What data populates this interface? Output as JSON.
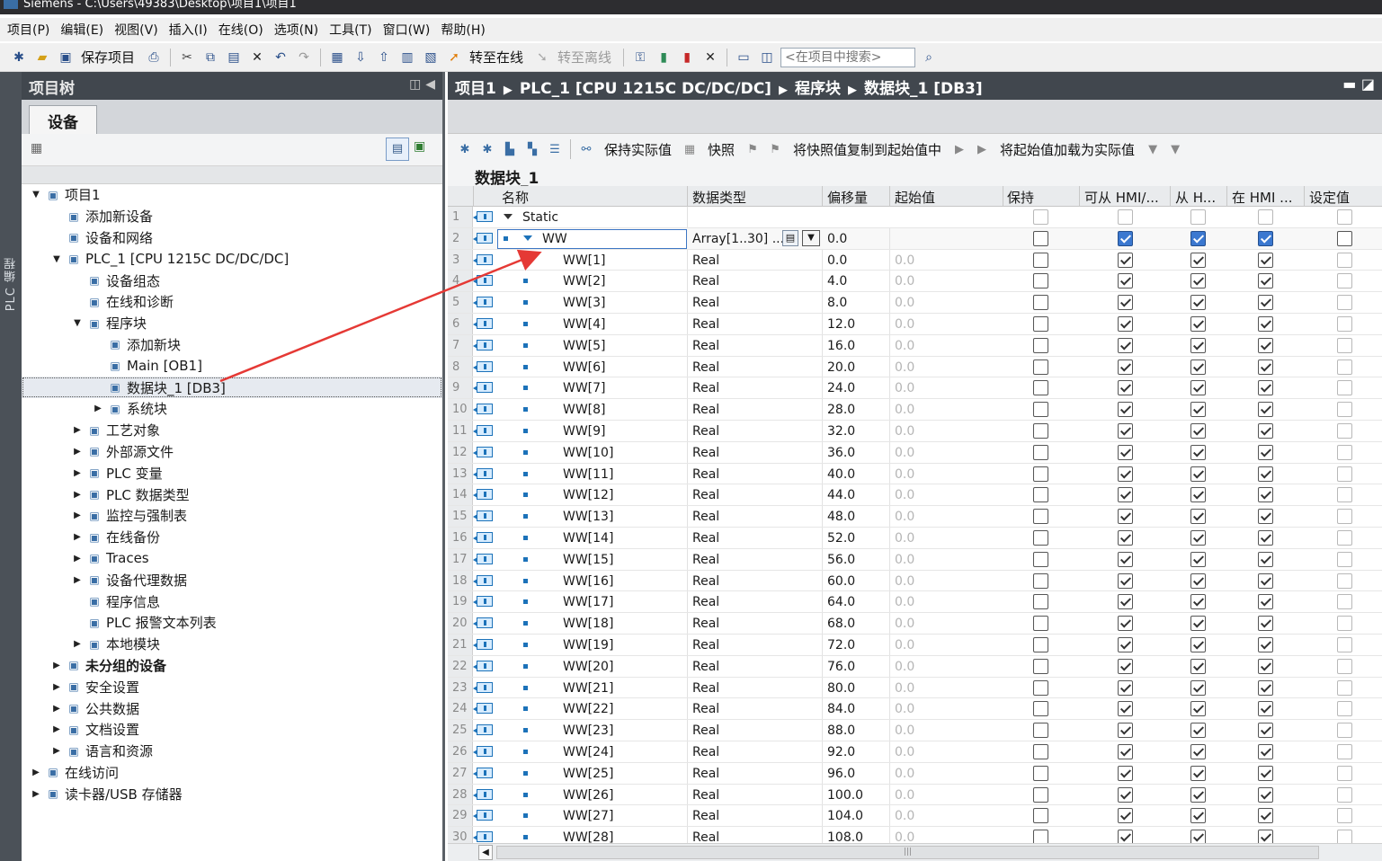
{
  "window": {
    "title": "Siemens  -  C:\\Users\\49383\\Desktop\\项目1\\项目1"
  },
  "menu": [
    "项目(P)",
    "编辑(E)",
    "视图(V)",
    "插入(I)",
    "在线(O)",
    "选项(N)",
    "工具(T)",
    "窗口(W)",
    "帮助(H)"
  ],
  "toolbar": {
    "save_project": "保存项目",
    "go_online": "转至在线",
    "go_offline": "转至离线",
    "search_placeholder": "<在项目中搜索>"
  },
  "left_strip": {
    "label": "PLC 编程"
  },
  "project_tree": {
    "title": "项目树",
    "tab": "设备",
    "items": [
      {
        "level": 0,
        "arrow": "open",
        "icon": "project-icon",
        "label": "项目1"
      },
      {
        "level": 1,
        "arrow": "none",
        "icon": "add-device-icon",
        "label": "添加新设备"
      },
      {
        "level": 1,
        "arrow": "none",
        "icon": "network-icon",
        "label": "设备和网络"
      },
      {
        "level": 1,
        "arrow": "open",
        "icon": "plc-icon",
        "label": "PLC_1 [CPU 1215C DC/DC/DC]"
      },
      {
        "level": 2,
        "arrow": "none",
        "icon": "device-config-icon",
        "label": "设备组态"
      },
      {
        "level": 2,
        "arrow": "none",
        "icon": "diagnostics-icon",
        "label": "在线和诊断"
      },
      {
        "level": 2,
        "arrow": "open",
        "icon": "folder-icon",
        "label": "程序块"
      },
      {
        "level": 3,
        "arrow": "none",
        "icon": "add-block-icon",
        "label": "添加新块"
      },
      {
        "level": 3,
        "arrow": "none",
        "icon": "ob-block-icon",
        "label": "Main [OB1]"
      },
      {
        "level": 3,
        "arrow": "none",
        "icon": "db-block-icon",
        "label": "数据块_1 [DB3]",
        "selected": true
      },
      {
        "level": 3,
        "arrow": "closed",
        "icon": "system-blocks-icon",
        "label": "系统块"
      },
      {
        "level": 2,
        "arrow": "closed",
        "icon": "technology-icon",
        "label": "工艺对象"
      },
      {
        "level": 2,
        "arrow": "closed",
        "icon": "source-file-icon",
        "label": "外部源文件"
      },
      {
        "level": 2,
        "arrow": "closed",
        "icon": "plc-tags-icon",
        "label": "PLC 变量"
      },
      {
        "level": 2,
        "arrow": "closed",
        "icon": "plc-datatype-icon",
        "label": "PLC 数据类型"
      },
      {
        "level": 2,
        "arrow": "closed",
        "icon": "watch-table-icon",
        "label": "监控与强制表"
      },
      {
        "level": 2,
        "arrow": "closed",
        "icon": "backup-icon",
        "label": "在线备份"
      },
      {
        "level": 2,
        "arrow": "closed",
        "icon": "traces-icon",
        "label": "Traces"
      },
      {
        "level": 2,
        "arrow": "closed",
        "icon": "proxy-data-icon",
        "label": "设备代理数据"
      },
      {
        "level": 2,
        "arrow": "none",
        "icon": "program-info-icon",
        "label": "程序信息"
      },
      {
        "level": 2,
        "arrow": "none",
        "icon": "alarm-text-icon",
        "label": "PLC 报警文本列表"
      },
      {
        "level": 2,
        "arrow": "closed",
        "icon": "local-modules-icon",
        "label": "本地模块"
      },
      {
        "level": 1,
        "arrow": "closed",
        "icon": "ungrouped-icon",
        "label": "未分组的设备",
        "bold": true
      },
      {
        "level": 1,
        "arrow": "closed",
        "icon": "security-icon",
        "label": "安全设置"
      },
      {
        "level": 1,
        "arrow": "closed",
        "icon": "common-data-icon",
        "label": "公共数据"
      },
      {
        "level": 1,
        "arrow": "closed",
        "icon": "doc-settings-icon",
        "label": "文档设置"
      },
      {
        "level": 1,
        "arrow": "closed",
        "icon": "language-icon",
        "label": "语言和资源"
      },
      {
        "level": 0,
        "arrow": "closed",
        "icon": "online-access-icon",
        "label": "在线访问"
      },
      {
        "level": 0,
        "arrow": "closed",
        "icon": "card-reader-icon",
        "label": "读卡器/USB 存储器"
      }
    ]
  },
  "breadcrumb": [
    "项目1",
    "PLC_1 [CPU 1215C DC/DC/DC]",
    "程序块",
    "数据块_1 [DB3]"
  ],
  "editor_toolbar": {
    "keep_actual": "保持实际值",
    "snapshot": "快照",
    "copy_snapshot": "将快照值复制到起始值中",
    "load_start": "将起始值加载为实际值"
  },
  "block": {
    "title": "数据块_1",
    "columns": [
      "名称",
      "数据类型",
      "偏移量",
      "起始值",
      "保持",
      "可从 HMI/...",
      "从 H...",
      "在 HMI ...",
      "设定值"
    ],
    "static_label": "Static",
    "array_row": {
      "num": "2",
      "name": "WW",
      "type": "Array[1..30] ...",
      "offset": "0.0"
    },
    "rows": [
      {
        "num": "3",
        "name": "WW[1]",
        "type": "Real",
        "offset": "0.0",
        "start": "0.0"
      },
      {
        "num": "4",
        "name": "WW[2]",
        "type": "Real",
        "offset": "4.0",
        "start": "0.0"
      },
      {
        "num": "5",
        "name": "WW[3]",
        "type": "Real",
        "offset": "8.0",
        "start": "0.0"
      },
      {
        "num": "6",
        "name": "WW[4]",
        "type": "Real",
        "offset": "12.0",
        "start": "0.0"
      },
      {
        "num": "7",
        "name": "WW[5]",
        "type": "Real",
        "offset": "16.0",
        "start": "0.0"
      },
      {
        "num": "8",
        "name": "WW[6]",
        "type": "Real",
        "offset": "20.0",
        "start": "0.0"
      },
      {
        "num": "9",
        "name": "WW[7]",
        "type": "Real",
        "offset": "24.0",
        "start": "0.0"
      },
      {
        "num": "10",
        "name": "WW[8]",
        "type": "Real",
        "offset": "28.0",
        "start": "0.0"
      },
      {
        "num": "11",
        "name": "WW[9]",
        "type": "Real",
        "offset": "32.0",
        "start": "0.0"
      },
      {
        "num": "12",
        "name": "WW[10]",
        "type": "Real",
        "offset": "36.0",
        "start": "0.0"
      },
      {
        "num": "13",
        "name": "WW[11]",
        "type": "Real",
        "offset": "40.0",
        "start": "0.0"
      },
      {
        "num": "14",
        "name": "WW[12]",
        "type": "Real",
        "offset": "44.0",
        "start": "0.0"
      },
      {
        "num": "15",
        "name": "WW[13]",
        "type": "Real",
        "offset": "48.0",
        "start": "0.0"
      },
      {
        "num": "16",
        "name": "WW[14]",
        "type": "Real",
        "offset": "52.0",
        "start": "0.0"
      },
      {
        "num": "17",
        "name": "WW[15]",
        "type": "Real",
        "offset": "56.0",
        "start": "0.0"
      },
      {
        "num": "18",
        "name": "WW[16]",
        "type": "Real",
        "offset": "60.0",
        "start": "0.0"
      },
      {
        "num": "19",
        "name": "WW[17]",
        "type": "Real",
        "offset": "64.0",
        "start": "0.0"
      },
      {
        "num": "20",
        "name": "WW[18]",
        "type": "Real",
        "offset": "68.0",
        "start": "0.0"
      },
      {
        "num": "21",
        "name": "WW[19]",
        "type": "Real",
        "offset": "72.0",
        "start": "0.0"
      },
      {
        "num": "22",
        "name": "WW[20]",
        "type": "Real",
        "offset": "76.0",
        "start": "0.0"
      },
      {
        "num": "23",
        "name": "WW[21]",
        "type": "Real",
        "offset": "80.0",
        "start": "0.0"
      },
      {
        "num": "24",
        "name": "WW[22]",
        "type": "Real",
        "offset": "84.0",
        "start": "0.0"
      },
      {
        "num": "25",
        "name": "WW[23]",
        "type": "Real",
        "offset": "88.0",
        "start": "0.0"
      },
      {
        "num": "26",
        "name": "WW[24]",
        "type": "Real",
        "offset": "92.0",
        "start": "0.0"
      },
      {
        "num": "27",
        "name": "WW[25]",
        "type": "Real",
        "offset": "96.0",
        "start": "0.0"
      },
      {
        "num": "28",
        "name": "WW[26]",
        "type": "Real",
        "offset": "100.0",
        "start": "0.0"
      },
      {
        "num": "29",
        "name": "WW[27]",
        "type": "Real",
        "offset": "104.0",
        "start": "0.0"
      },
      {
        "num": "30",
        "name": "WW[28]",
        "type": "Real",
        "offset": "108.0",
        "start": "0.0"
      }
    ]
  },
  "colors": {
    "accent": "#1c72b9",
    "header_bg": "#41474e",
    "annotation_arrow": "#e53935"
  }
}
